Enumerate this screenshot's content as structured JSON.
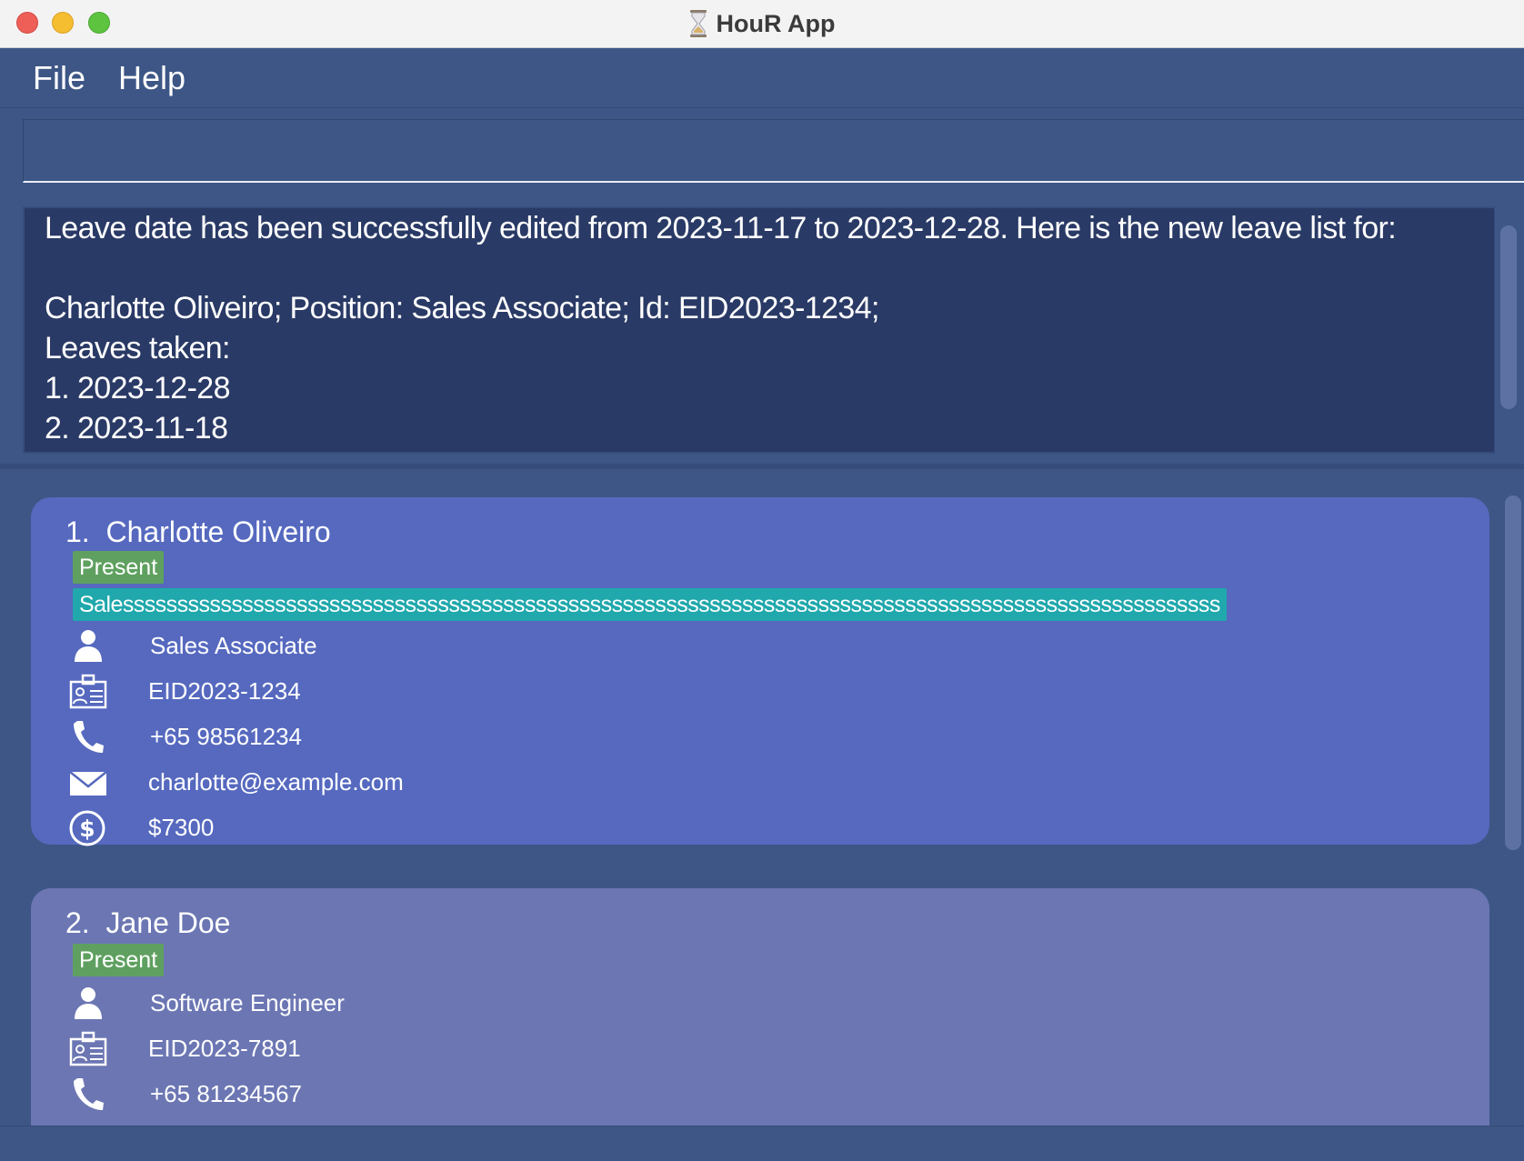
{
  "window": {
    "title": "HouR App",
    "hourglass_icon": "hourglass-icon"
  },
  "menubar": {
    "file_label": "File",
    "help_label": "Help"
  },
  "command_box": {
    "value": "",
    "placeholder": ""
  },
  "result": {
    "text": "Leave date has been successfully edited from 2023-11-17 to 2023-12-28. Here is the new leave list for:\n\nCharlotte Oliveiro; Position: Sales Associate; Id: EID2023-1234;\nLeaves taken:\n1. 2023-12-28\n2. 2023-11-18"
  },
  "colors": {
    "background": "#3d5686",
    "result_background": "#2a3a66",
    "selected_card": "#5669bf",
    "card": "#6b76b3",
    "present_badge": "#5fa060",
    "department_badge": "#20a8ac"
  },
  "employees": [
    {
      "index_name": "1.  Charlotte Oliveiro",
      "status": "Present",
      "department": "Salesssssssssssssssssssssssssssssssssssssssssssssssssssssssssssssssssssssssssssssssssssssssssssssssssssss",
      "position": "Sales Associate",
      "id": "EID2023-1234",
      "phone": "+65 98561234",
      "email": "charlotte@example.com",
      "salary": "$7300",
      "selected": true
    },
    {
      "index_name": "2.  Jane Doe",
      "status": "Present",
      "position": "Software Engineer",
      "id": "EID2023-7891",
      "phone": "+65 81234567",
      "selected": false
    }
  ]
}
